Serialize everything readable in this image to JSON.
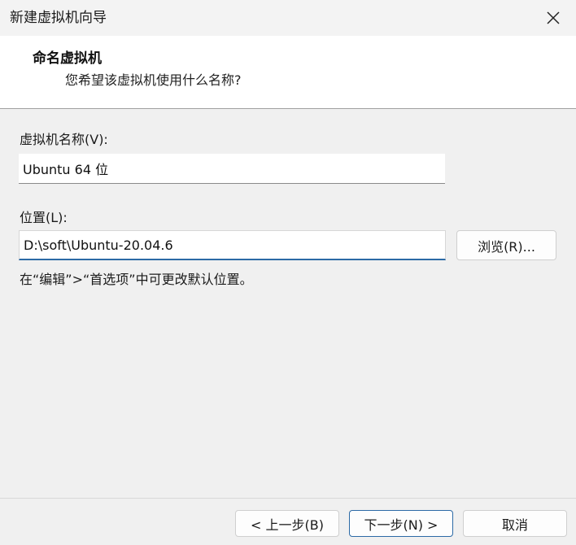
{
  "window": {
    "title": "新建虚拟机向导",
    "close_icon": "close-icon"
  },
  "header": {
    "title": "命名虚拟机",
    "subtitle": "您希望该虚拟机使用什么名称?"
  },
  "form": {
    "vm_name_label": "虚拟机名称(V):",
    "vm_name_value": "Ubuntu 64 位",
    "location_label": "位置(L):",
    "location_value": "D:\\soft\\Ubuntu-20.04.6",
    "browse_label": "浏览(R)...",
    "hint": "在“编辑”>“首选项”中可更改默认位置。"
  },
  "footer": {
    "back_label": "< 上一步(B)",
    "next_label": "下一步(N) >",
    "cancel_label": "取消"
  }
}
